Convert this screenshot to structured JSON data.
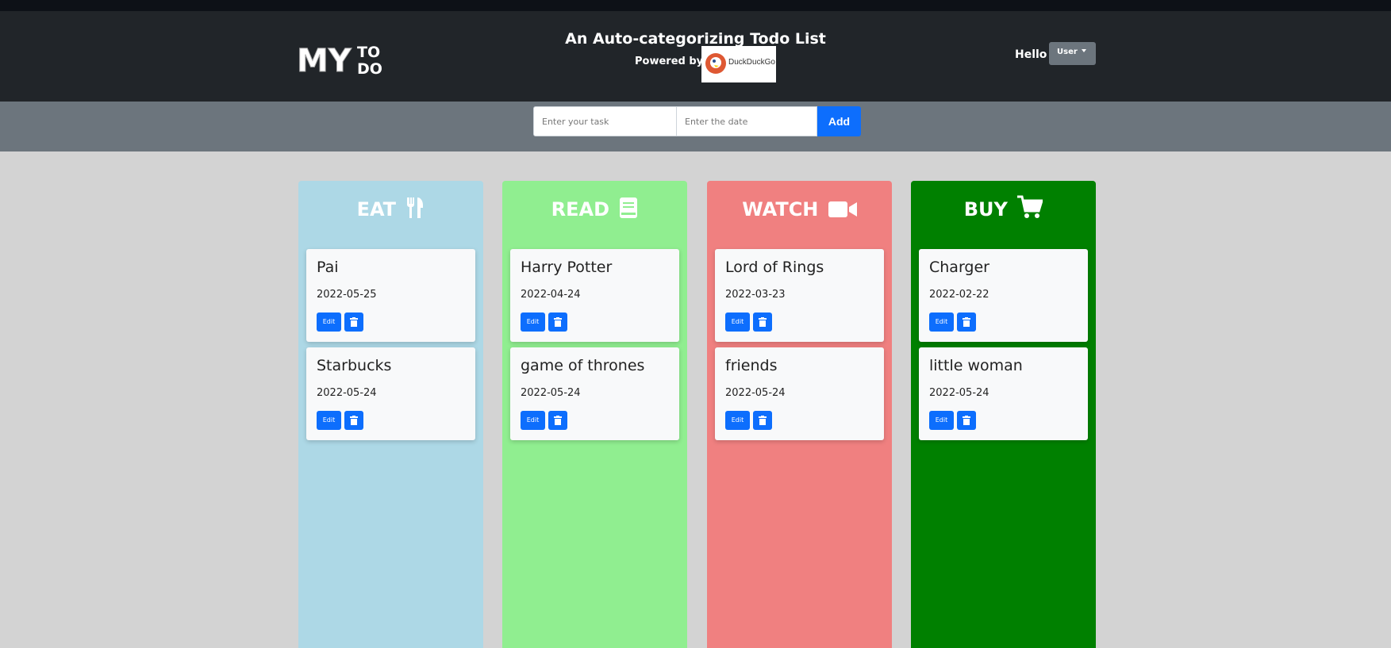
{
  "header": {
    "title": "An Auto-categorizing Todo List",
    "powered_by": "Powered by",
    "powered_brand": "DuckDuckGo",
    "logo_text": "MY TO DO",
    "greeting": "Hello",
    "user_menu": "User"
  },
  "form": {
    "task_placeholder": "Enter your task",
    "date_placeholder": "Enter the date",
    "add_label": "Add"
  },
  "columns": [
    {
      "label": "EAT",
      "icon": "utensils-icon",
      "color": "#add8e6",
      "tasks": [
        {
          "title": "Pai",
          "date": "2022-05-25"
        },
        {
          "title": "Starbucks",
          "date": "2022-05-24"
        }
      ]
    },
    {
      "label": "READ",
      "icon": "book-icon",
      "color": "#90ee90",
      "tasks": [
        {
          "title": "Harry Potter",
          "date": "2022-04-24"
        },
        {
          "title": "game of thrones",
          "date": "2022-05-24"
        }
      ]
    },
    {
      "label": "WATCH",
      "icon": "video-camera-icon",
      "color": "#f08080",
      "tasks": [
        {
          "title": "Lord of Rings",
          "date": "2022-03-23"
        },
        {
          "title": "friends",
          "date": "2022-05-24"
        }
      ]
    },
    {
      "label": "BUY",
      "icon": "cart-icon",
      "color": "#008000",
      "tasks": [
        {
          "title": "Charger",
          "date": "2022-02-22"
        },
        {
          "title": "little woman",
          "date": "2022-05-24"
        }
      ]
    }
  ],
  "card_actions": {
    "edit_label": "Edit",
    "delete_icon": "trash-icon"
  },
  "colors": {
    "navbar": "#212529",
    "subbar": "#6c757d",
    "primary": "#0d6efd",
    "background": "#d3d3d3"
  }
}
